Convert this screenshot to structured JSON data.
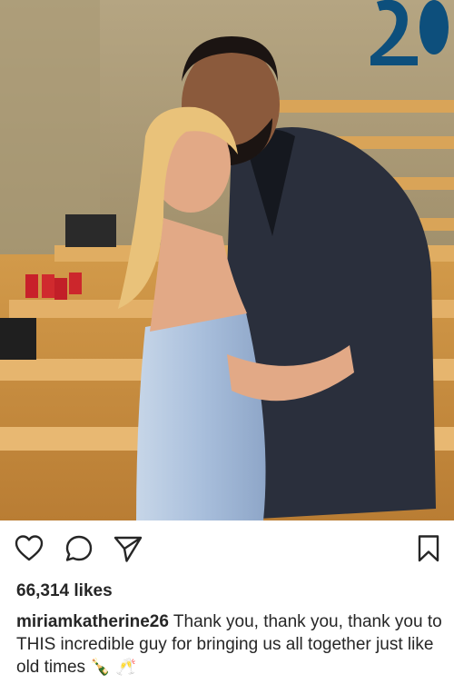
{
  "post": {
    "photo_alt": "",
    "likes_text": "66,314 likes",
    "username": "miriamkatherine26",
    "caption": "Thank you, thank you, thank you to THIS incredible guy for bringing us all together just like old times",
    "caption_emoji": "🍾 🥂"
  },
  "actions": {
    "like_icon": "heart-icon",
    "comment_icon": "speech-bubble-icon",
    "share_icon": "paper-plane-icon",
    "save_icon": "bookmark-icon"
  },
  "colors": {
    "text": "#262626",
    "icon": "#262626",
    "background": "#ffffff"
  }
}
